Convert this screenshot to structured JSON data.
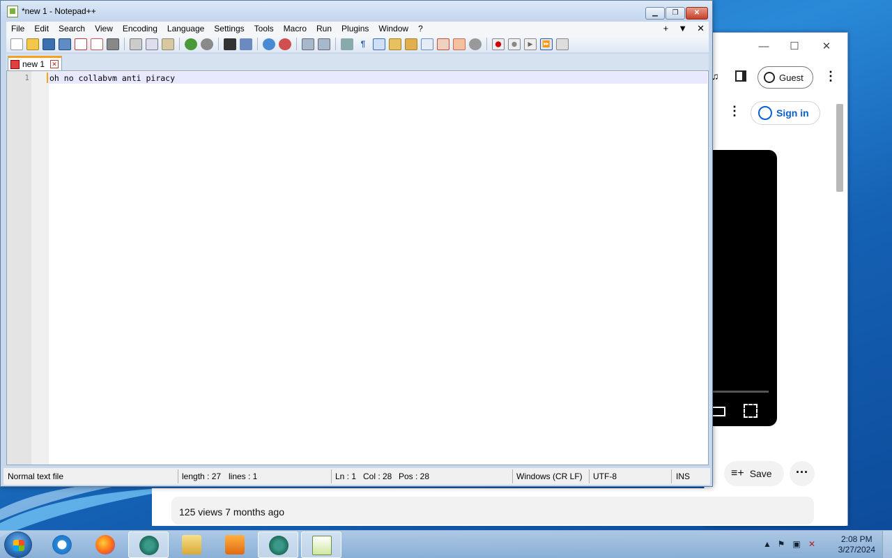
{
  "notepad": {
    "title": "*new 1 - Notepad++",
    "menu": [
      "File",
      "Edit",
      "Search",
      "View",
      "Encoding",
      "Language",
      "Settings",
      "Tools",
      "Macro",
      "Run",
      "Plugins",
      "Window",
      "?"
    ],
    "menu_right": [
      "+",
      "▼",
      "✕"
    ],
    "tab_label": "new 1",
    "line_number": "1",
    "content": "oh no collabvm anti piracy",
    "status": {
      "file_type": "Normal text file",
      "length": "length : 27",
      "lines": "lines : 1",
      "ln": "Ln : 1",
      "col": "Col : 28",
      "pos": "Pos : 28",
      "eol": "Windows (CR LF)",
      "encoding": "UTF-8",
      "mode": "INS"
    }
  },
  "browser": {
    "guest_label": "Guest",
    "signin_label": "Sign in",
    "save_label": "Save",
    "views_text": "125 views  7 months ago"
  },
  "taskbar": {
    "time": "2:08 PM",
    "date": "3/27/2024"
  },
  "colors": {
    "accent_tab": "#f7a21e",
    "youtube_blue": "#065fd4",
    "close_red": "#c5412a"
  }
}
